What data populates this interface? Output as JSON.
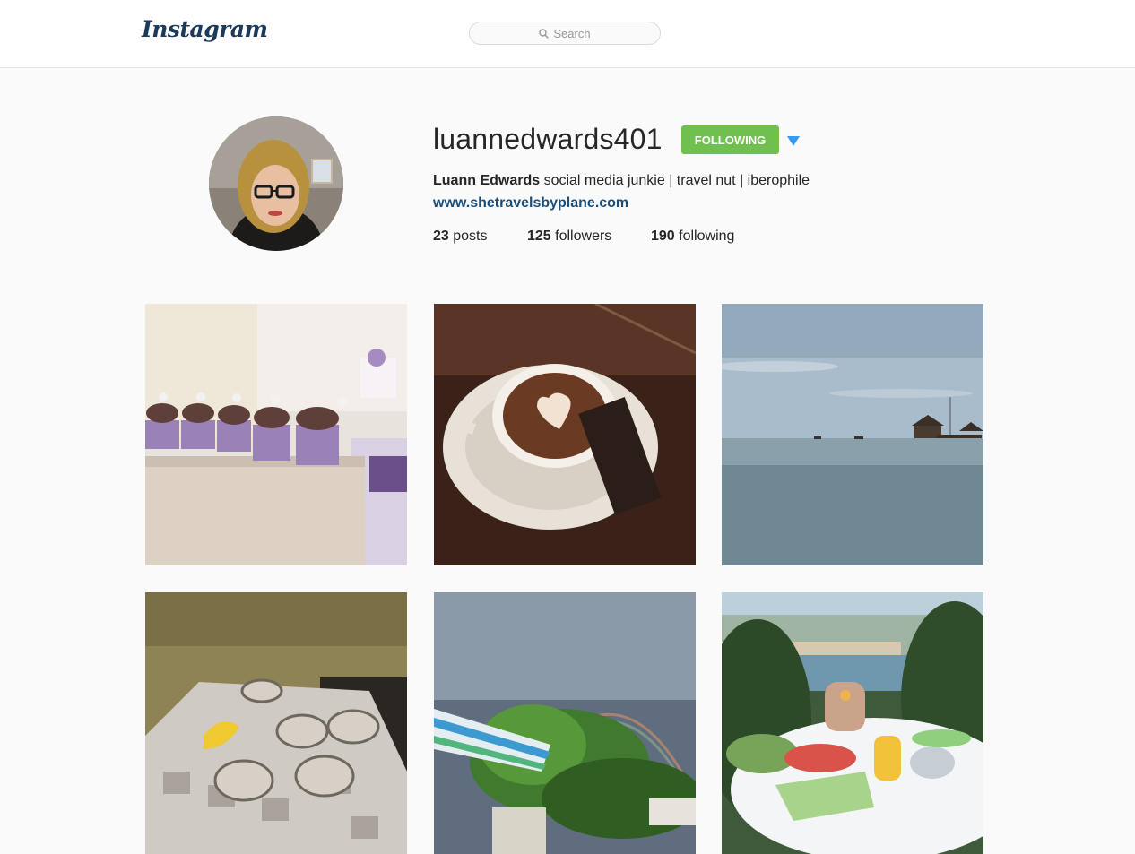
{
  "header": {
    "logo_text": "Instagram",
    "search_placeholder": "Search"
  },
  "profile": {
    "username": "luannedwards401",
    "follow_label": "FOLLOWING",
    "full_name": "Luann Edwards",
    "bio": "social media junkie | travel nut | iberophile",
    "website": "www.shetravelsbyplane.com",
    "stats": {
      "posts_count": "23",
      "posts_label": "posts",
      "followers_count": "125",
      "followers_label": "followers",
      "following_count": "190",
      "following_label": "following"
    }
  },
  "colors": {
    "follow_green": "#70c050",
    "link_blue": "#1c4e7a",
    "dropdown_blue": "#3897f0"
  },
  "posts": [
    {
      "subject": "cupcakes"
    },
    {
      "subject": "latte"
    },
    {
      "subject": "sea-pier"
    },
    {
      "subject": "oysters"
    },
    {
      "subject": "rainbow"
    },
    {
      "subject": "lake-dinner"
    }
  ]
}
